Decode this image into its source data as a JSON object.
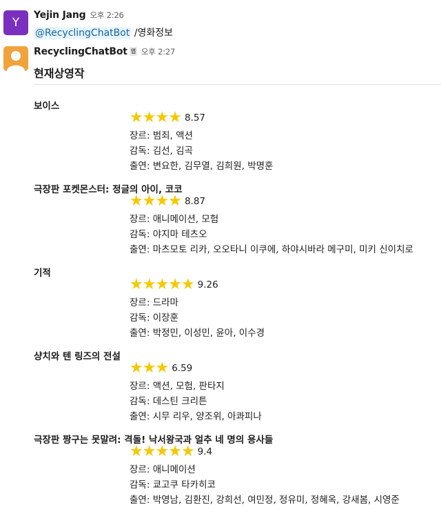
{
  "user_message": {
    "avatar_letter": "Y",
    "sender": "Yejin Jang",
    "time": "오후 2:26",
    "mention": "@RecyclingChatBot",
    "command": "/영화정보"
  },
  "bot_message": {
    "sender": "RecyclingChatBot",
    "badge": "앱",
    "time": "오후 2:27",
    "heading": "현재상영작"
  },
  "labels": {
    "genre": "장르: ",
    "director": "감독: ",
    "cast": "출연: "
  },
  "movies": [
    {
      "title": "보이스",
      "stars": 4,
      "rating": "8.57",
      "genre": "범죄, 액션",
      "director": "김선, 김곡",
      "cast": "변요한, 김무열, 김희원, 박명훈"
    },
    {
      "title": "극장판 포켓몬스터: 정글의 아이, 코코",
      "stars": 4,
      "rating": "8.87",
      "genre": "애니메이션, 모험",
      "director": "야지마 테츠오",
      "cast": "마츠모토 리카, 오오타니 이쿠에, 하야시바라 메구미, 미키 신이치로"
    },
    {
      "title": "기적",
      "stars": 5,
      "rating": "9.26",
      "genre": "드라마",
      "director": "이장훈",
      "cast": "박정민, 이성민, 윤아, 이수경"
    },
    {
      "title": "샹치와 텐 링즈의 전설",
      "stars": 3,
      "rating": "6.59",
      "genre": "액션, 모험, 판타지",
      "director": "데스틴 크리튼",
      "cast": "시무 리우, 양조위, 아콰피나"
    },
    {
      "title": "극장판 짱구는 못말려: 격돌! 낙서왕국과 얼추 네 명의 용사들",
      "stars": 5,
      "rating": "9.4",
      "genre": "애니메이션",
      "director": "쿄고쿠 타카히코",
      "cast": "박영남, 김환진, 강희선, 여민정, 정유미, 정혜옥, 강새봄, 시영준"
    }
  ],
  "colors": {
    "avatar_user": "#7b2fbf",
    "avatar_bot": "#f0a33c",
    "mention": "#1264a3",
    "star": "#f5c800"
  },
  "icons": {
    "star": "star-icon",
    "bot_avatar": "person-silhouette-icon"
  }
}
